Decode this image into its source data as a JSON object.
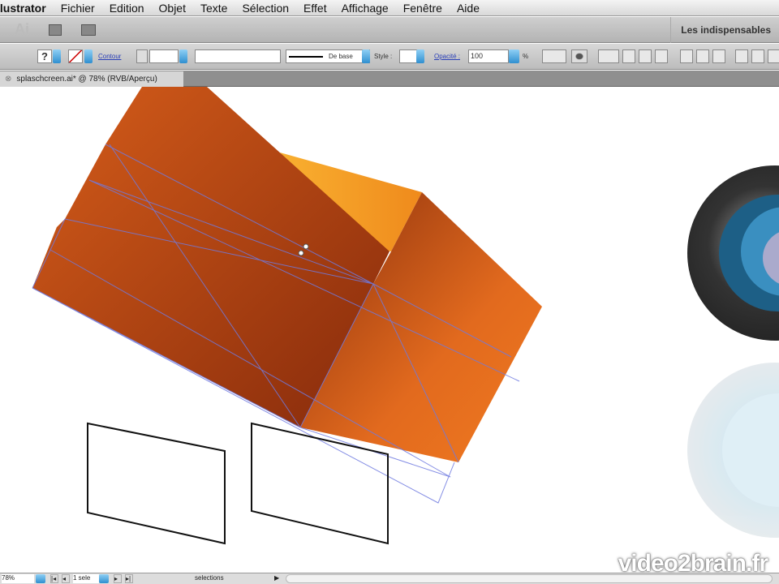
{
  "menubar": {
    "items": [
      "llustrator",
      "Fichier",
      "Edition",
      "Objet",
      "Texte",
      "Sélection",
      "Effet",
      "Affichage",
      "Fenêtre",
      "Aide"
    ]
  },
  "appbar": {
    "logo": "Ai",
    "workspace": "Les indispensables"
  },
  "control": {
    "fill_label": "?",
    "stroke_label": "Contour",
    "stroke_style": "De base",
    "style_label": "Style :",
    "opacity_label": "Opacité :",
    "opacity_value": "100",
    "percent": "%"
  },
  "document_tab": {
    "title": "splaschcreen.ai* @ 78% (RVB/Aperçu)"
  },
  "status": {
    "zoom": "78%",
    "artboard": "1 sele",
    "info": "selections"
  },
  "watermark": "video2brain.fr",
  "colors": {
    "orange_dark": "#8a2e0c",
    "orange_light": "#f6a030",
    "guide": "#6f7ae0",
    "accent": "#2f8fd0"
  }
}
